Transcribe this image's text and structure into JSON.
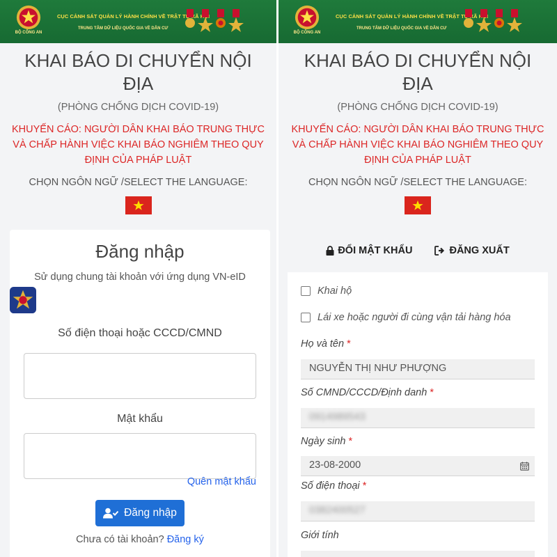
{
  "header": {
    "org_title": "CỤC CẢNH SÁT QUẢN LÝ HÀNH CHÍNH VỀ TRẬT TỰ XÃ HỘI",
    "org_sub": "TRUNG TÂM DỮ LIỆU QUỐC GIA VỀ DÂN CƯ",
    "emblem_label": "BỘ CÔNG AN"
  },
  "page": {
    "title": "KHAI BÁO DI CHUYỂN NỘI ĐỊA",
    "subtitle": "(PHÒNG CHỐNG DỊCH COVID-19)",
    "warning": "KHUYẾN CÁO: NGƯỜI DÂN KHAI BÁO TRUNG THỰC VÀ CHẤP HÀNH VIỆC KHAI BÁO NGHIÊM THEO QUY ĐỊNH CỦA PHÁP LUẬT",
    "language_label": "CHỌN NGÔN NGỮ /SELECT THE LANGUAGE:"
  },
  "login": {
    "title": "Đăng nhập",
    "description": "Sử dụng chung tài khoản với ứng dụng VN-eID",
    "phone_label": "Số điện thoại hoặc CCCD/CMND",
    "phone_value": "",
    "password_label": "Mật khẩu",
    "password_value": "",
    "forgot_label": "Quên mật khẩu",
    "button_label": "Đăng nhập",
    "no_account_text": "Chưa có tài khoản?",
    "signup_label": "Đăng ký"
  },
  "account_actions": {
    "change_password": "ĐỔI MẬT KHẨU",
    "logout": "ĐĂNG XUẤT"
  },
  "declaration_form": {
    "declare_for_other": "Khai hộ",
    "driver_option": "Lái xe hoặc người đi cùng vận tải hàng hóa",
    "required_mark": "*",
    "fullname_label": "Họ và tên",
    "fullname_value": "NGUYỄN THỊ NHƯ PHƯỢNG",
    "id_label": "Số CMND/CCCD/Định danh",
    "id_value": "0914989543",
    "dob_label": "Ngày sinh",
    "dob_value": "23-08-2000",
    "phone_label": "Số điện thoại",
    "phone_value": "0382400527",
    "gender_label": "Giới tính"
  },
  "colors": {
    "header_green": "#1f7a3b",
    "warning_red": "#dc2626",
    "primary_blue": "#1f6fd6",
    "link_blue": "#2563eb"
  }
}
